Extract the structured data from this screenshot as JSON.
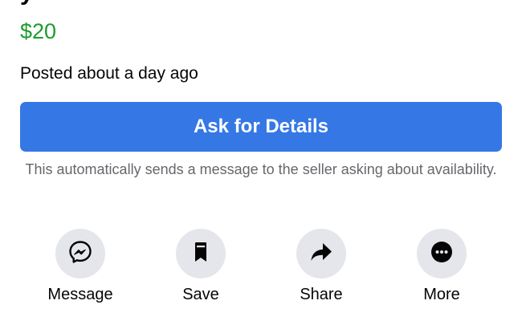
{
  "listing": {
    "price": "$20",
    "posted": "Posted about a day ago",
    "price_color": "#1b9c2e"
  },
  "primary_action": {
    "label": "Ask for Details",
    "color": "#3578e5"
  },
  "disclaimer": "This automatically sends a message to the seller asking about availability.",
  "actions": [
    {
      "label": "Message",
      "icon": "messenger-icon"
    },
    {
      "label": "Save",
      "icon": "bookmark-icon"
    },
    {
      "label": "Share",
      "icon": "share-arrow-icon"
    },
    {
      "label": "More",
      "icon": "more-dots-icon"
    }
  ]
}
